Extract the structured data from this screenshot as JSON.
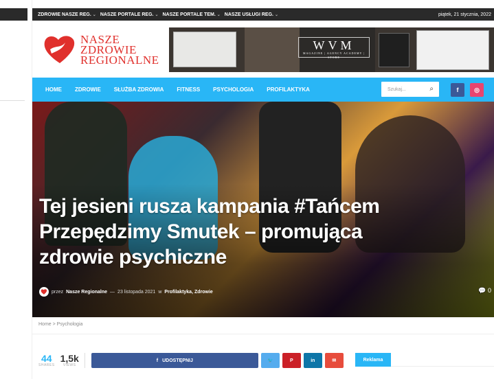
{
  "topbar": {
    "nav": [
      "ZDROWIE NASZE REG.",
      "NASZE PORTALE REG.",
      "NASZE PORTALE TEM.",
      "NASZE USŁUGI REG."
    ],
    "date": "piątek, 21 stycznia, 2022"
  },
  "logo": {
    "line1": "NASZE",
    "line2": "ZDROWIE",
    "line3": "REGIONALNE"
  },
  "banner": {
    "brand": "WVM",
    "tagline": "MAGAZINE | AGENCY ACADEMY | STORE"
  },
  "mainnav": {
    "items": [
      "HOME",
      "ZDROWIE",
      "SŁUŻBA ZDROWIA",
      "FITNESS",
      "PSYCHOLOGIA",
      "PROFILAKTYKA"
    ],
    "search_placeholder": "Szukaj...",
    "facebook": "f",
    "instagram": "◎"
  },
  "article": {
    "title": "Tej jesieni rusza kampania #Tańcem Przepędzimy Smutek – promująca zdrowie psychiczne",
    "by": "przez",
    "author": "Nasze Regionalne",
    "dash": "—",
    "date": "23 listopada 2021",
    "in": "w",
    "categories": "Profilaktyka, Zdrowie",
    "comments": "0"
  },
  "breadcrumb": "Home > Psychologia",
  "share": {
    "shares_num": "44",
    "shares_lbl": "SHARES",
    "views_num": "1,5k",
    "views_lbl": "VIEWS",
    "facebook_label": "UDOSTĘPNIJ"
  },
  "sidebar": {
    "reklama": "Reklama"
  },
  "colors": {
    "accent": "#29b6f6",
    "brand_red": "#e0302c",
    "topbar": "#2a2a2a"
  }
}
